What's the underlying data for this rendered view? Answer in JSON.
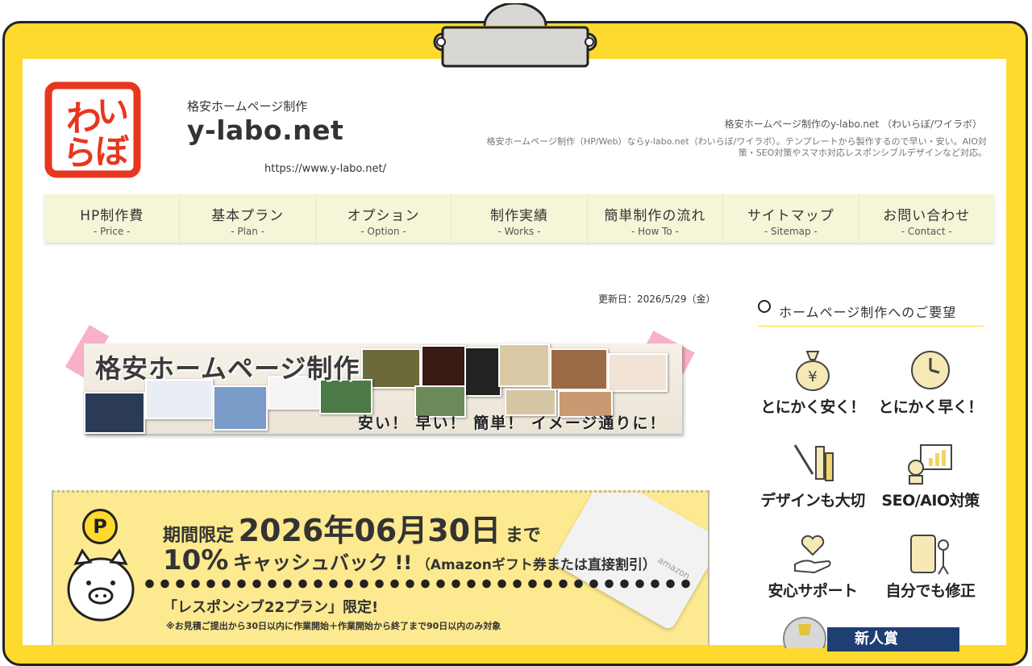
{
  "header": {
    "subtitle": "格安ホームページ制作",
    "site_name": "y-labo.net",
    "url": "https://www.y-labo.net/",
    "tagline": "格安ホームページ制作のy-labo.net （わいらぼ/ワイラボ）",
    "description": "格安ホームページ制作（HP/Web）ならy-labo.net（わいらぼ/ワイラボ）。テンプレートから製作するので早い・安い。AIO対策・SEO対策やスマホ対応レスポンシブルデザインなど対応。"
  },
  "nav": [
    {
      "label": "HP制作費",
      "sub": "- Price -"
    },
    {
      "label": "基本プラン",
      "sub": "- Plan -"
    },
    {
      "label": "オプション",
      "sub": "- Option -"
    },
    {
      "label": "制作実績",
      "sub": "- Works -"
    },
    {
      "label": "簡単制作の流れ",
      "sub": "- How To -"
    },
    {
      "label": "サイトマップ",
      "sub": "- Sitemap -"
    },
    {
      "label": "お問い合わせ",
      "sub": "- Contact -"
    }
  ],
  "updated": "更新日：2026/5/29（金）",
  "hero": {
    "title": "格安ホームページ制作",
    "subtitle": "安い！ 早い！ 簡単！ イメージ通りに！"
  },
  "campaign": {
    "badge": "P",
    "period_label": "期間限定",
    "date": "2026年06月30日",
    "until": "まで",
    "percent": "10%",
    "cashback": "キャッシュバック !!",
    "method": "（Amazonギフト券または直接割引）",
    "plan": "「レスポンシブ22プラン」限定!",
    "note": "※お見積ご提出から30日以内に作業開始＋作業開始から終了まで90日以内のみ対象",
    "card_brand": "amazon"
  },
  "sidebar": {
    "title": "ホームページ制作へのご要望",
    "features": [
      {
        "label": "とにかく安く！",
        "icon": "money-bag-icon"
      },
      {
        "label": "とにかく早く！",
        "icon": "clock-icon"
      },
      {
        "label": "デザインも大切",
        "icon": "paint-brush-icon"
      },
      {
        "label": "SEO/AIO対策",
        "icon": "seo-chart-icon"
      },
      {
        "label": "安心サポート",
        "icon": "heart-hand-icon"
      },
      {
        "label": "自分でも修正",
        "icon": "tablet-edit-icon"
      }
    ],
    "award_text": "新人賞"
  },
  "colors": {
    "board": "#fed92e",
    "nav_bg": "#f5f5d8",
    "campaign_bg": "#fde98f",
    "logo_red": "#e8361e",
    "tape_pink": "#f7a9c0"
  }
}
